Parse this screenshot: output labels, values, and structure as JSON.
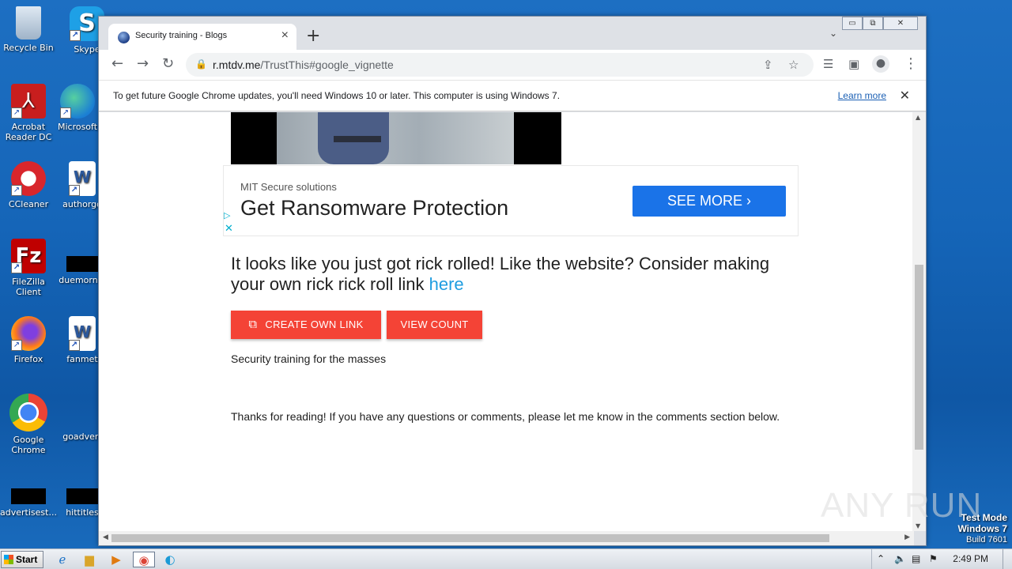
{
  "desktop": {
    "icons": [
      {
        "label": "Recycle Bin",
        "icon": "recycle-bin-icon"
      },
      {
        "label": "Skype",
        "icon": "skype-icon"
      },
      {
        "label": "Acrobat Reader DC",
        "icon": "acrobat-icon"
      },
      {
        "label": "Microsoft",
        "icon": "edge-icon"
      },
      {
        "label": "CCleaner",
        "icon": "ccleaner-icon"
      },
      {
        "label": "authorgo",
        "icon": "word-doc-icon"
      },
      {
        "label": "FileZilla Client",
        "icon": "filezilla-icon"
      },
      {
        "label": "duemornin",
        "icon": "black-file-icon"
      },
      {
        "label": "Firefox",
        "icon": "firefox-icon"
      },
      {
        "label": "fanmet",
        "icon": "word-doc-icon"
      },
      {
        "label": "Google Chrome",
        "icon": "chrome-icon"
      },
      {
        "label": "goadvert",
        "icon": "blank-file-icon"
      },
      {
        "label": "advertisest...",
        "icon": "black-file-icon"
      },
      {
        "label": "hittitles",
        "icon": "black-file-icon"
      }
    ]
  },
  "browser": {
    "tab_title": "Security training - Blogs",
    "url_domain": "r.mtdv.me",
    "url_path": "/TrustThis#google_vignette",
    "window_controls": {
      "minimize": "▭",
      "restore": "⧉",
      "close": "✕"
    },
    "infobar": {
      "message": "To get future Google Chrome updates, you'll need Windows 10 or later. This computer is using Windows 7.",
      "link": "Learn more"
    }
  },
  "page": {
    "ad": {
      "brand": "MIT Secure solutions",
      "headline": "Get Ransomware Protection",
      "cta": "SEE MORE"
    },
    "rick_text": "It looks like you just got rick rolled! Like the website? Consider making your own rick rick roll link ",
    "rick_link": "here",
    "buttons": {
      "create": "CREATE OWN LINK",
      "view": "VIEW COUNT"
    },
    "tagline": "Security training for the masses",
    "thanks": "Thanks for reading! If you have any questions or comments, please let me know in the comments section below.",
    "colors": {
      "button": "#f44336",
      "link": "#1e9de0",
      "cta": "#1a73e8"
    }
  },
  "overlay": {
    "watermark": "ANY RUN",
    "test_mode": "Test Mode",
    "windows": "Windows 7",
    "build": "Build 7601"
  },
  "taskbar": {
    "start": "Start",
    "clock": "2:49 PM"
  }
}
